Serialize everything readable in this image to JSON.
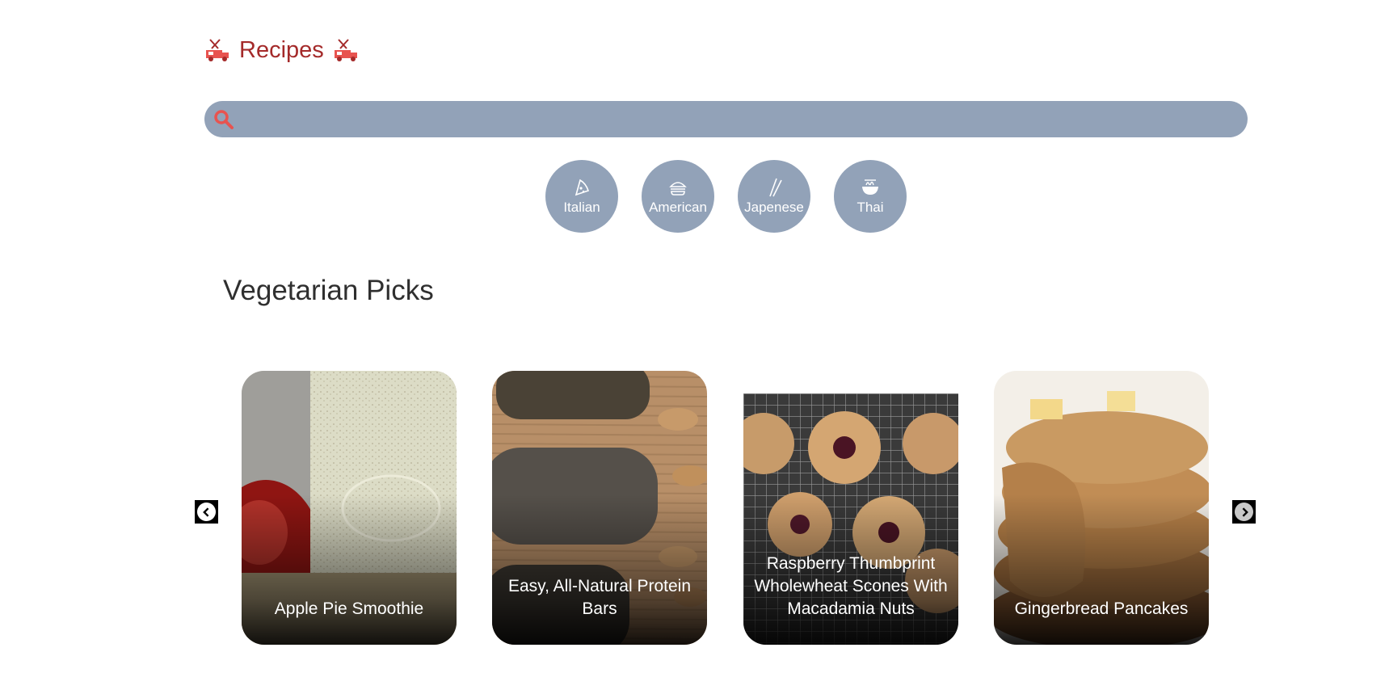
{
  "header": {
    "title": "Recipes",
    "logo_icon": "food-truck-icon",
    "accent": "#a42a2a"
  },
  "search": {
    "placeholder": "",
    "value": "",
    "icon": "search-icon",
    "background": "#92a2b8",
    "icon_color": "#e8534f"
  },
  "cuisines": [
    {
      "label": "Italian",
      "icon": "pizza-icon"
    },
    {
      "label": "American",
      "icon": "burger-icon"
    },
    {
      "label": "Japenese",
      "icon": "chopsticks-icon"
    },
    {
      "label": "Thai",
      "icon": "noodle-bowl-icon"
    }
  ],
  "section": {
    "title": "Vegetarian Picks"
  },
  "carousel": {
    "prev_icon": "chevron-left-icon",
    "next_icon": "chevron-right-icon",
    "cards": [
      {
        "title": "Apple Pie Smoothie"
      },
      {
        "title": "Easy, All-Natural Protein Bars"
      },
      {
        "title": "Raspberry Thumbprint Wholewheat Scones With Macadamia Nuts"
      },
      {
        "title": "Gingerbread Pancakes"
      }
    ]
  }
}
